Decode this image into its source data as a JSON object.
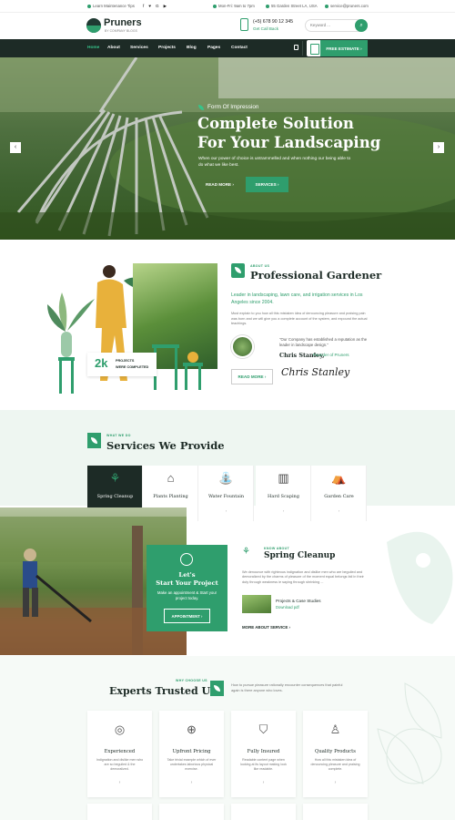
{
  "topbar": {
    "maintenance_tips": "Learn Maintenance Tips",
    "social_icons": [
      "facebook-icon",
      "twitter-icon",
      "google-icon",
      "youtube-icon"
    ],
    "hours": "Mon-Fri: 9am to 7pm",
    "address": "55 Garden Street LA, USA",
    "email": "service@pruners.com"
  },
  "header": {
    "logo_name": "Pruners",
    "logo_tagline": "BY COMPANY BLOGS",
    "phone": "(+5) 678 90 12 345",
    "callback": "Get Call Back",
    "search_placeholder": "Keyword ..."
  },
  "nav": {
    "items": [
      "Home",
      "About",
      "Services",
      "Projects",
      "Blog",
      "Pages",
      "Contact"
    ],
    "active": "Home",
    "estimate_label": "FREE ESTIMATE"
  },
  "hero": {
    "tag": "Form Of Impression",
    "title_line1": "Complete Solution",
    "title_line2": "For Your Landscaping",
    "description": "When our power of choice is untrammelled and when nothing our being able to do what we like best.",
    "read_more": "READ MORE",
    "services": "SERVICES"
  },
  "about": {
    "eyebrow": "ABOUT US",
    "title": "Professional Gardener",
    "lead": "Leader in landscaping, lawn care, and irrigation services in Los Angeles since 2004.",
    "text": "Must explain to you how all this mistaken idea of denouncing pleasure and praising pain was born and we will give you a complete account of the system, and expound the actual teachings.",
    "quote": "\"Our Company has established a reputation as the leader in landscape design.\"",
    "quote_name": "Chris Stanley,",
    "quote_role": "Founder of Pruners",
    "read_more": "READ MORE",
    "signature": "Chris Stanley",
    "stat_number": "2k",
    "stat_label_line1": "PROJECTS",
    "stat_label_line2": "WERE COMPLETED"
  },
  "services": {
    "eyebrow": "WHAT WE DO",
    "title": "Services We Provide",
    "cards": [
      {
        "label": "Spring Cleanup",
        "icon": "rake-icon"
      },
      {
        "label": "Plants Planting",
        "icon": "greenhouse-icon"
      },
      {
        "label": "Water Fountain",
        "icon": "fountain-icon"
      },
      {
        "label": "Hard Scaping",
        "icon": "fence-icon"
      },
      {
        "label": "Garden Care",
        "icon": "gazebo-icon"
      }
    ],
    "cta_title_line1": "Let's",
    "cta_title_line2": "Start Your Project",
    "cta_desc": "Make an appointment & Start your project today.",
    "cta_button": "APPOINTMENT",
    "detail_eyebrow": "KNOW ABOUT",
    "detail_title": "Spring Cleanup",
    "detail_text": "We denounce with righteous indignation and dislike men who are beguiled and demoralized by the charms of pleasure of the moment equal belongs fail in their duty through weakness ie saying through shrinking ...",
    "case_title": "Projects & Case Studies",
    "case_link": "Download pdf",
    "more_about": "MORE ABOUT SERVICE"
  },
  "experts": {
    "eyebrow": "WHY CHOOSE US",
    "title": "Experts Trusted Us",
    "description": "How to pursue pleasure rationally encounter consequences that painful again is there anyone who loves.",
    "features": [
      {
        "title": "Experienced",
        "desc": "Indignation and dislike men who are so beguiled & the demoralized.",
        "icon": "experience-icon"
      },
      {
        "title": "Upfront Pricing",
        "desc": "Take trivial example which of ever undertakes laborious physical exercise.",
        "icon": "pricing-icon"
      },
      {
        "title": "Fully Insured",
        "desc": "Readable content page when looking at its layout making look like readable.",
        "icon": "insurance-icon"
      },
      {
        "title": "Quality Products",
        "desc": "How all this mistaken idea of denouncing pleasure and praising complete.",
        "icon": "quality-icon"
      }
    ]
  },
  "colors": {
    "accent": "#2f9e6d",
    "dark": "#1d2b26"
  }
}
